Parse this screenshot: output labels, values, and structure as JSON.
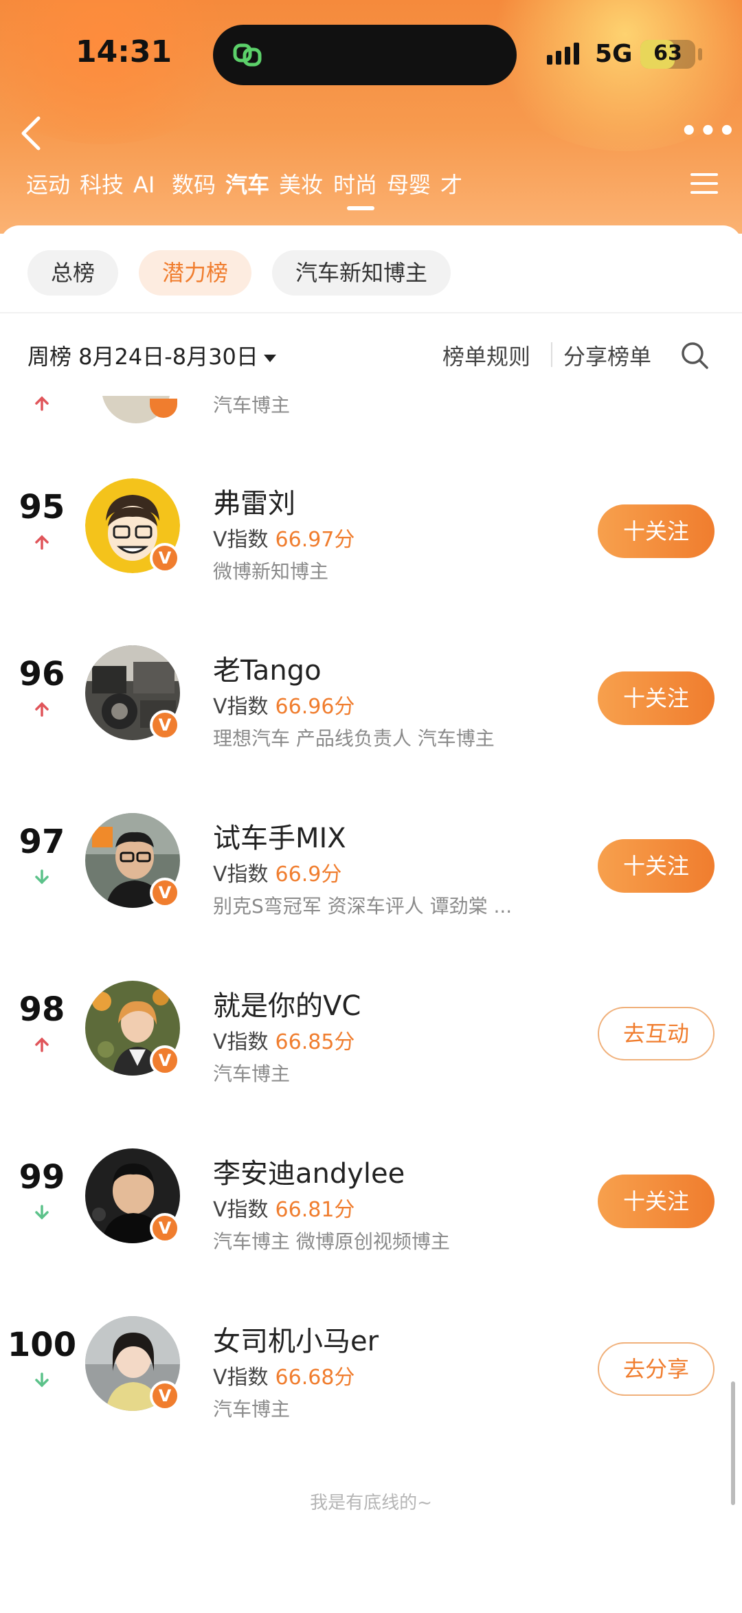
{
  "status_bar": {
    "time": "14:31",
    "network": "5G",
    "battery": "63",
    "battery_level": 0.63
  },
  "header": {
    "tabs": [
      "运动",
      "科技",
      "AI",
      "数码",
      "汽车",
      "美妆",
      "时尚",
      "母婴",
      "才"
    ],
    "active_tab": "汽车",
    "icons": [
      "back-icon",
      "more-icon",
      "menu-icon"
    ]
  },
  "chips": {
    "items": [
      "总榜",
      "潜力榜",
      "汽车新知博主"
    ],
    "active": "潜力榜"
  },
  "filter": {
    "label": "周榜 8月24日-8月30日",
    "rules": "榜单规则",
    "share": "分享榜单"
  },
  "partial_row": {
    "desc": "汽车博主"
  },
  "rows": [
    {
      "rank": "95",
      "trend": "up",
      "name": "弗雷刘",
      "v_label": "V指数",
      "score": "66.97分",
      "desc": "微博新知博主",
      "button": "十关注",
      "button_type": "follow"
    },
    {
      "rank": "96",
      "trend": "up",
      "name": "老Tango",
      "v_label": "V指数",
      "score": "66.96分",
      "desc": "理想汽车 产品线负责人 汽车博主",
      "button": "十关注",
      "button_type": "follow"
    },
    {
      "rank": "97",
      "trend": "down",
      "name": "试车手MIX",
      "v_label": "V指数",
      "score": "66.9分",
      "desc": "别克S弯冠军 资深车评人 谭劲棠 ...",
      "button": "十关注",
      "button_type": "follow"
    },
    {
      "rank": "98",
      "trend": "up",
      "name": "就是你的VC",
      "v_label": "V指数",
      "score": "66.85分",
      "desc": "汽车博主",
      "button": "去互动",
      "button_type": "outline"
    },
    {
      "rank": "99",
      "trend": "down",
      "name": "李安迪andylee",
      "v_label": "V指数",
      "score": "66.81分",
      "desc": "汽车博主 微博原创视频博主",
      "button": "十关注",
      "button_type": "follow"
    },
    {
      "rank": "100",
      "trend": "down",
      "name": "女司机小马er",
      "v_label": "V指数",
      "score": "66.68分",
      "desc": "汽车博主",
      "button": "去分享",
      "button_type": "outline"
    }
  ],
  "badge_letter": "V",
  "footer": "我是有底线的~",
  "colors": {
    "accent": "#f07d2e",
    "up": "#e0555a",
    "down": "#5cc28a"
  }
}
